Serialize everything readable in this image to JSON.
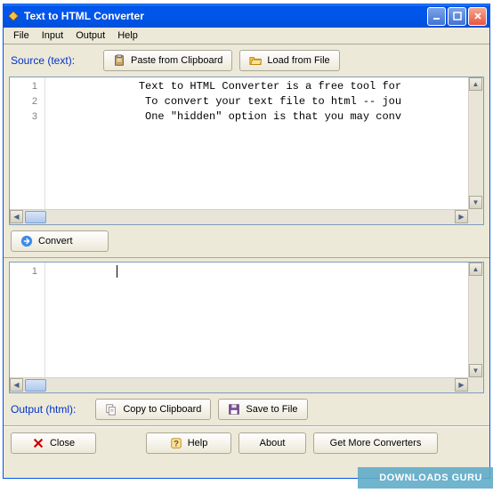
{
  "window": {
    "title": "Text to HTML Converter"
  },
  "menu": {
    "file": "File",
    "input": "Input",
    "output": "Output",
    "help": "Help"
  },
  "source": {
    "label": "Source (text):",
    "paste_btn": "Paste from Clipboard",
    "load_btn": "Load from File",
    "lines": [
      "1",
      "2",
      "3"
    ],
    "code": "              Text to HTML Converter is a free tool for\n               To convert your text file to html -- jou\n               One \"hidden\" option is that you may conv"
  },
  "convert": {
    "label": "Convert"
  },
  "result": {
    "lines": [
      "1"
    ],
    "code": "                         "
  },
  "output": {
    "label": "Output (html):",
    "copy_btn": "Copy to Clipboard",
    "save_btn": "Save to File"
  },
  "footer": {
    "close": "Close",
    "help": "Help",
    "about": "About",
    "more": "Get More Converters"
  },
  "watermark": "DOWNLOADS   GURU"
}
